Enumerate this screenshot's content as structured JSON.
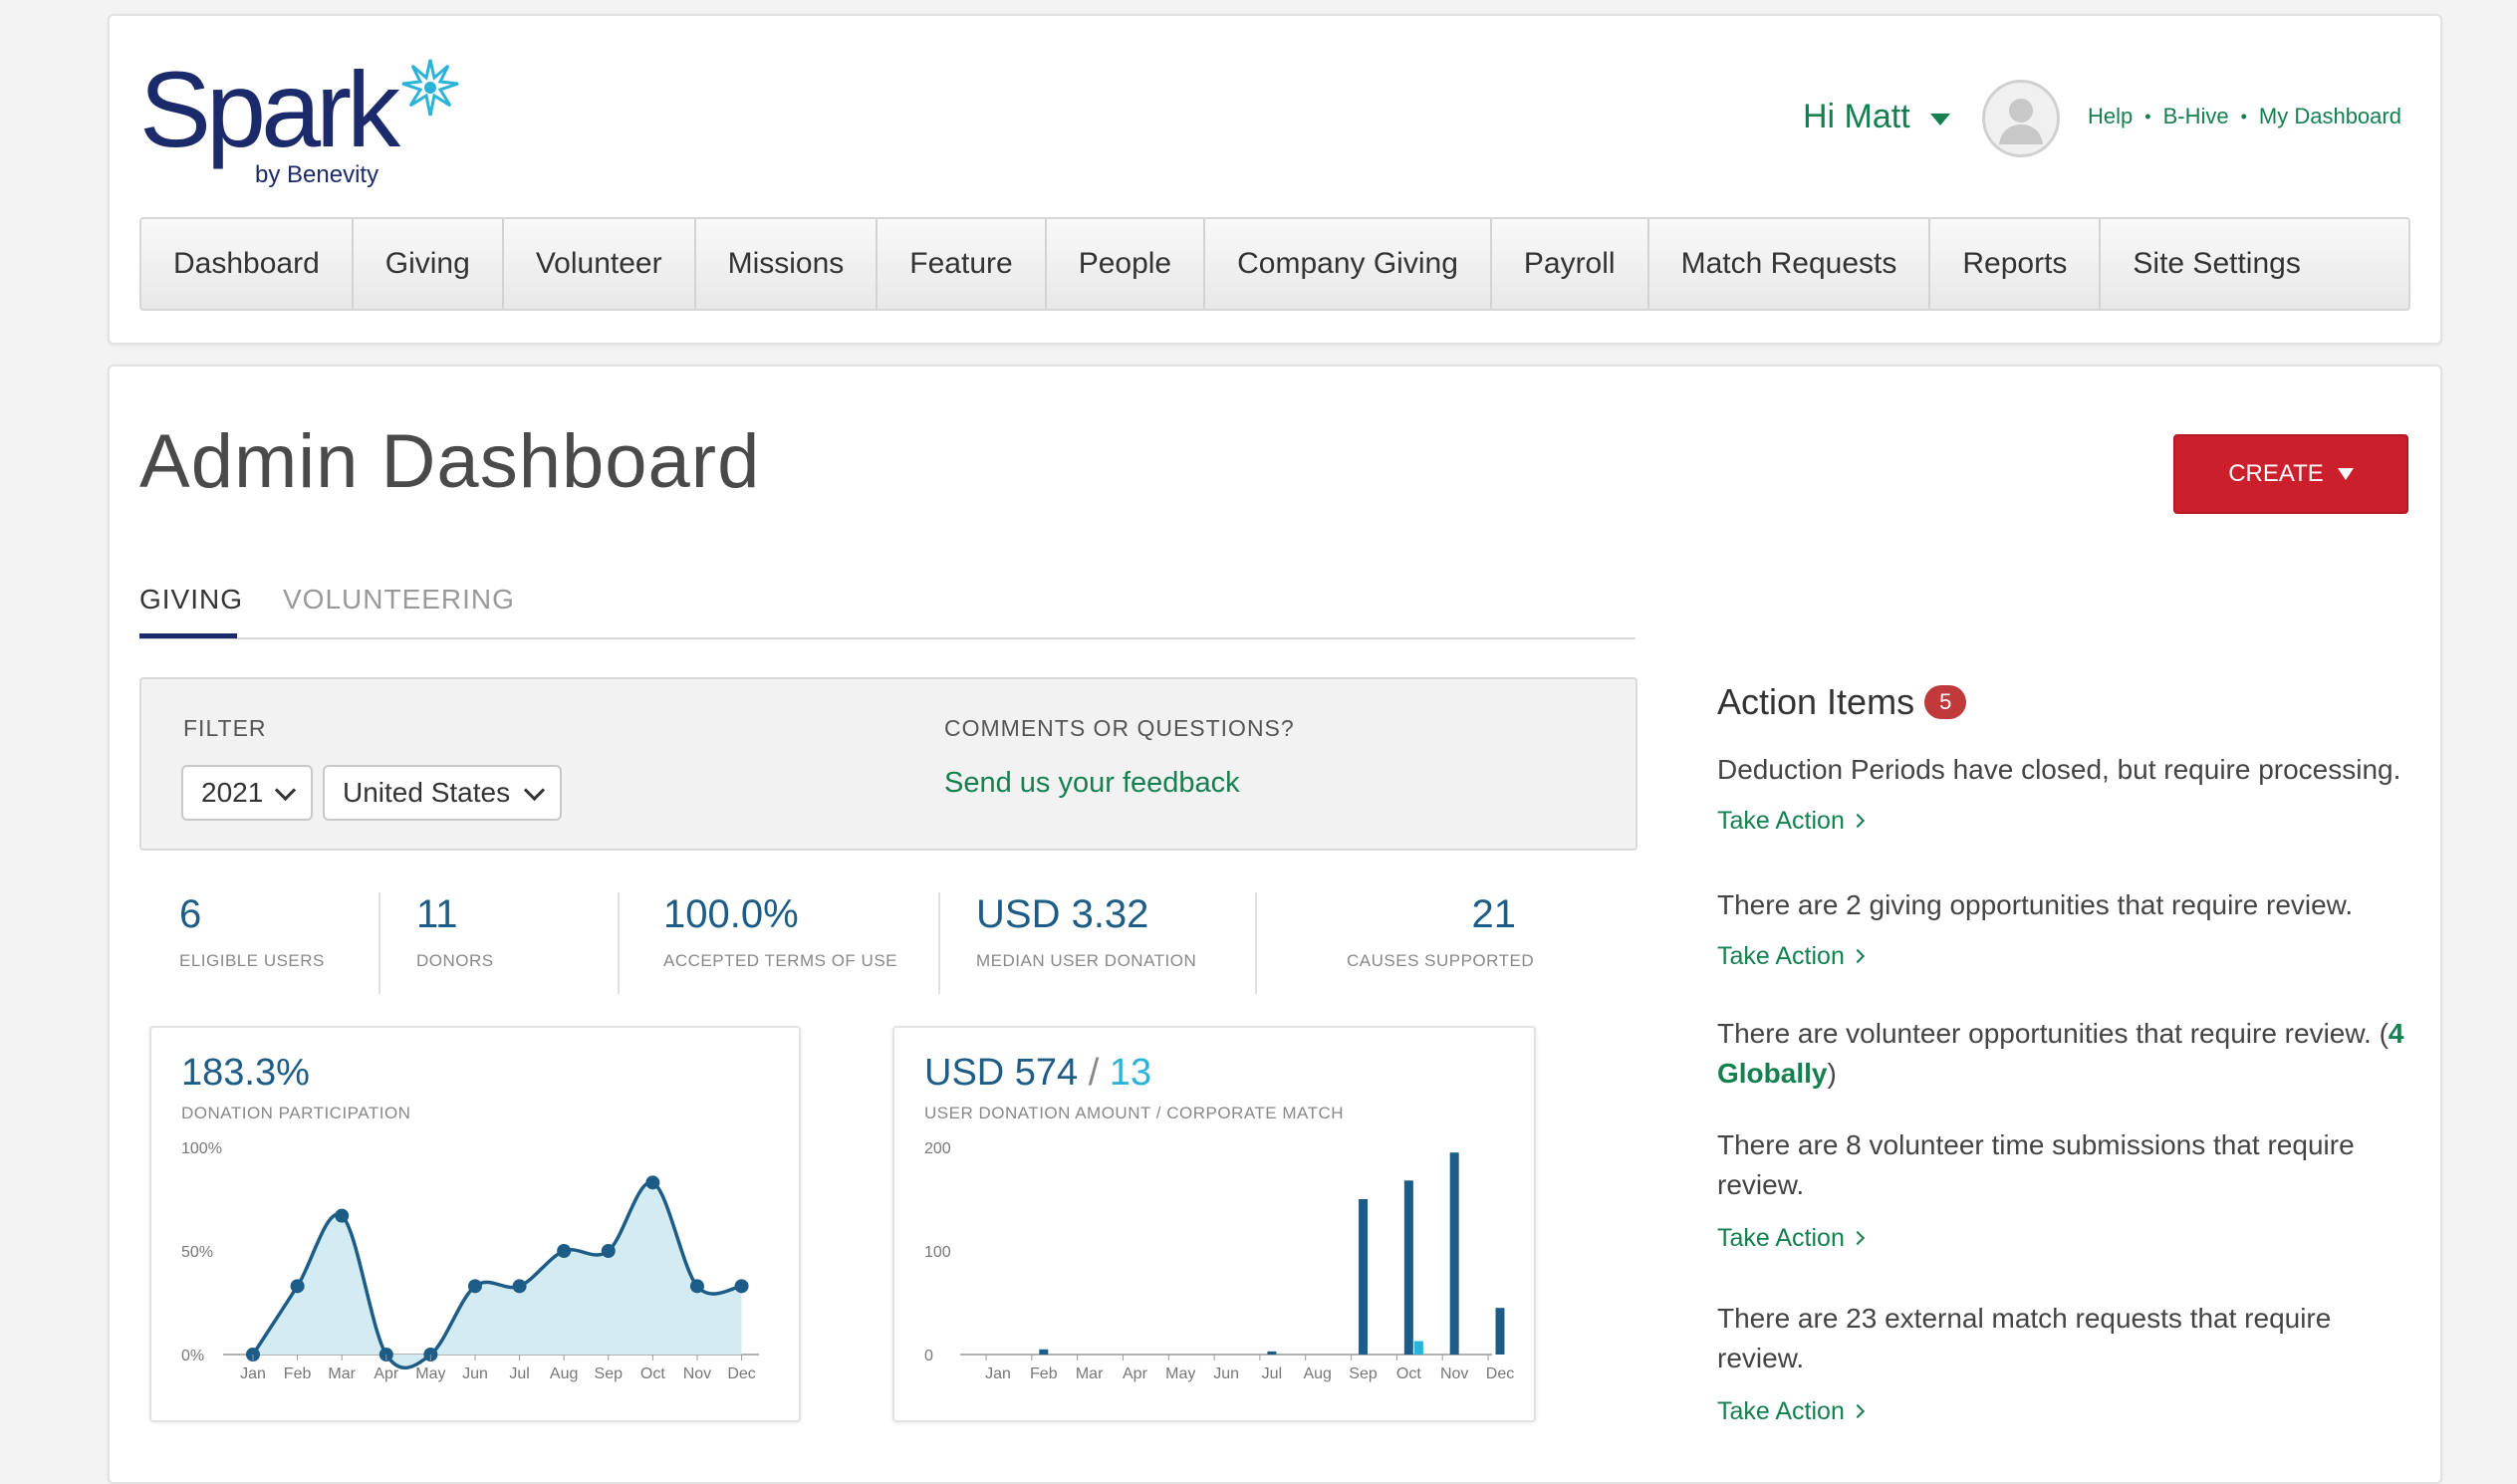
{
  "brand": {
    "logo_word": "Spark",
    "logo_sub": "by Benevity",
    "colors": {
      "navy": "#1b2a6b",
      "green": "#15804f",
      "red": "#cc1f2c",
      "teal": "#1c5c86",
      "light_teal": "#2ab3d8"
    }
  },
  "user": {
    "greeting": "Hi Matt"
  },
  "toplinks": [
    "Help",
    "B-Hive",
    "My Dashboard"
  ],
  "nav": [
    "Dashboard",
    "Giving",
    "Volunteer",
    "Missions",
    "Feature",
    "People",
    "Company Giving",
    "Payroll",
    "Match Requests",
    "Reports",
    "Site Settings"
  ],
  "page": {
    "title": "Admin Dashboard",
    "create_label": "CREATE"
  },
  "tabs": {
    "giving": "GIVING",
    "volunteering": "VOLUNTEERING"
  },
  "filter": {
    "label": "FILTER",
    "year": "2021",
    "country": "United States",
    "comments_label": "COMMENTS OR QUESTIONS?",
    "feedback_link": "Send us your feedback"
  },
  "stats": [
    {
      "value": "6",
      "label": "ELIGIBLE USERS"
    },
    {
      "value": "11",
      "label": "DONORS"
    },
    {
      "value": "100.0%",
      "label": "ACCEPTED TERMS OF USE"
    },
    {
      "value": "USD 3.32",
      "label": "MEDIAN USER DONATION"
    },
    {
      "value": "21",
      "label": "CAUSES SUPPORTED"
    }
  ],
  "participation": {
    "headline": "183.3%",
    "subtitle": "DONATION PARTICIPATION"
  },
  "donation": {
    "amount": "USD 574",
    "separator": "/",
    "match": "13",
    "subtitle": "USER DONATION AMOUNT / CORPORATE MATCH"
  },
  "chart_data": [
    {
      "type": "area",
      "title": "DONATION PARTICIPATION",
      "categories": [
        "Jan",
        "Feb",
        "Mar",
        "Apr",
        "May",
        "Jun",
        "Jul",
        "Aug",
        "Sep",
        "Oct",
        "Nov",
        "Dec"
      ],
      "values": [
        0,
        33,
        67,
        0,
        0,
        33,
        33,
        50,
        50,
        83,
        33,
        33
      ],
      "yticks": [
        "0%",
        "50%",
        "100%"
      ],
      "ylim": [
        0,
        100
      ],
      "color": "#1c5c86",
      "fill": "#d3ebf3"
    },
    {
      "type": "bar",
      "title": "USER DONATION AMOUNT / CORPORATE MATCH",
      "categories": [
        "Jan",
        "Feb",
        "Mar",
        "Apr",
        "May",
        "Jun",
        "Jul",
        "Aug",
        "Sep",
        "Oct",
        "Nov",
        "Dec"
      ],
      "series": [
        {
          "values": [
            0,
            5,
            0,
            0,
            0,
            0,
            3,
            0,
            150,
            168,
            195,
            45
          ],
          "color": "#1c5c86"
        },
        {
          "values": [
            0,
            0,
            0,
            0,
            0,
            0,
            0,
            0,
            0,
            13,
            0,
            0
          ],
          "color": "#2ab3d8"
        }
      ],
      "yticks": [
        "0",
        "100",
        "200"
      ],
      "ylim": [
        0,
        200
      ]
    }
  ],
  "action_items": {
    "title": "Action Items",
    "count": "5",
    "take_action": "Take Action",
    "items": [
      {
        "text": "Deduction Periods have closed, but require processing."
      },
      {
        "text": "There are 2 giving opportunities that require review."
      },
      {
        "text_pre": "There are volunteer opportunities that require review. (",
        "link": "4 Globally",
        "text_post": ")"
      },
      {
        "text": "There are 8 volunteer time submissions that require review."
      },
      {
        "text": "There are 23 external match requests that require review."
      }
    ]
  }
}
